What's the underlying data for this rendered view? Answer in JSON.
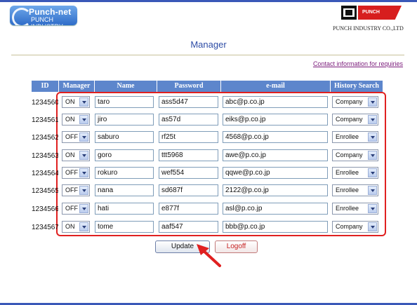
{
  "header": {
    "logo_left_line1": "Punch-net",
    "logo_left_line2": "PUNCH INDUSTRY",
    "logo_right_banner": "PUNCH INDUSTRY",
    "company_name": "PUNCH INDUSTRY CO.,LTD"
  },
  "page": {
    "title": "Manager",
    "contact_link": "Contact information for requiries"
  },
  "columns": [
    "ID",
    "Manager",
    "Name",
    "Password",
    "e-mail",
    "History Search"
  ],
  "rows": [
    {
      "id": "1234560",
      "manager": "ON",
      "name": "taro",
      "password": "ass5d47",
      "email": "abc@p.co.jp",
      "history": "Company"
    },
    {
      "id": "1234561",
      "manager": "ON",
      "name": "jiro",
      "password": "as57d",
      "email": "eiks@p.co.jp",
      "history": "Company"
    },
    {
      "id": "1234562",
      "manager": "OFF",
      "name": "saburo",
      "password": "rf25t",
      "email": "4568@p.co.jp",
      "history": "Enrollee"
    },
    {
      "id": "1234563",
      "manager": "ON",
      "name": "goro",
      "password": "ttt5968",
      "email": "awe@p.co.jp",
      "history": "Company"
    },
    {
      "id": "1234564",
      "manager": "OFF",
      "name": "rokuro",
      "password": "wef554",
      "email": "qqwe@p.co.jp",
      "history": "Enrollee"
    },
    {
      "id": "1234565",
      "manager": "OFF",
      "name": "nana",
      "password": "sd687f",
      "email": "2122@p.co.jp",
      "history": "Enrollee"
    },
    {
      "id": "1234566",
      "manager": "OFF",
      "name": "hati",
      "password": "e877f",
      "email": "asl@p.co.jp",
      "history": "Enrollee"
    },
    {
      "id": "1234567",
      "manager": "ON",
      "name": "tome",
      "password": "aaf547",
      "email": "bbb@p.co.jp",
      "history": "Company"
    }
  ],
  "buttons": {
    "update": "Update",
    "logoff": "Logoff"
  },
  "colors": {
    "header_bg": "#5d86cc",
    "title": "#2e4da6",
    "highlight_border": "#e02020",
    "annotation_arrow": "#e02020",
    "link": "#7a1a7a"
  },
  "icons": {
    "select_arrow": "chevron-down-icon",
    "annotation": "red-pointer-arrow-icon"
  }
}
